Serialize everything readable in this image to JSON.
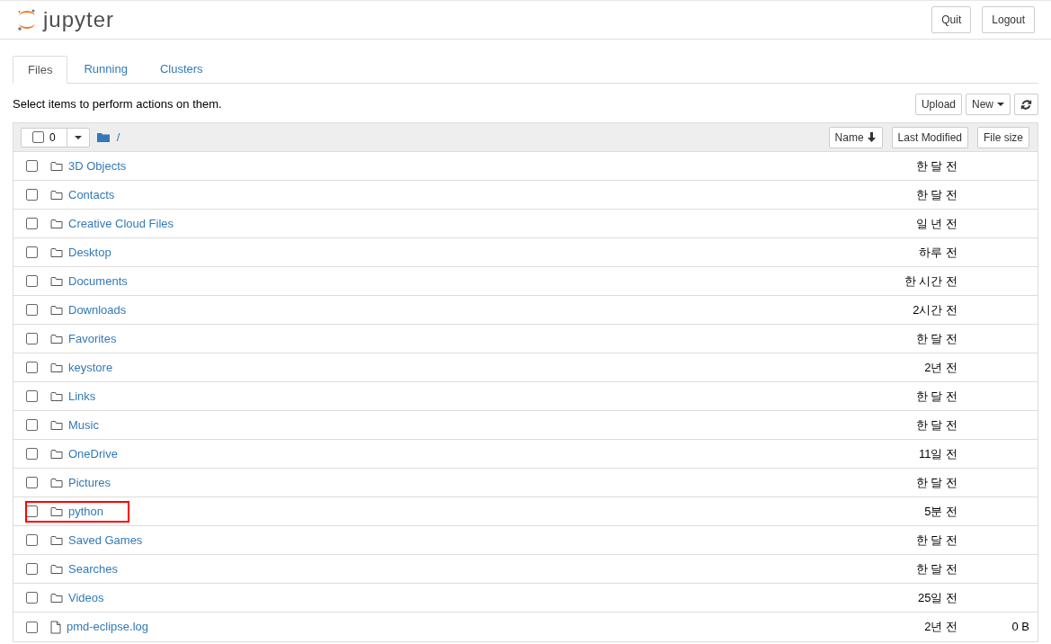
{
  "header": {
    "logo": "jupyter",
    "buttons": [
      "Quit",
      "Logout"
    ]
  },
  "tabs": [
    {
      "label": "Files",
      "selected": true
    },
    {
      "label": "Running",
      "selected": false
    },
    {
      "label": "Clusters",
      "selected": false
    }
  ],
  "toolbar": {
    "hint": "Select items to perform actions on them.",
    "upload": "Upload",
    "new": "New"
  },
  "list_header": {
    "checked": false,
    "count": "0",
    "path": "/",
    "sort_buttons": [
      "Name",
      "Last Modified",
      "File size"
    ]
  },
  "rows": [
    {
      "kind": "folder",
      "name": "3D Objects",
      "modified": "한 달 전",
      "checked": false,
      "highlighted": false
    },
    {
      "kind": "folder",
      "name": "Contacts",
      "modified": "한 달 전",
      "checked": false,
      "highlighted": false
    },
    {
      "kind": "folder",
      "name": "Creative Cloud Files",
      "modified": "일 년 전",
      "checked": false,
      "highlighted": false
    },
    {
      "kind": "folder",
      "name": "Desktop",
      "modified": "하루 전",
      "checked": false,
      "highlighted": false
    },
    {
      "kind": "folder",
      "name": "Documents",
      "modified": "한 시간 전",
      "checked": false,
      "highlighted": false
    },
    {
      "kind": "folder",
      "name": "Downloads",
      "modified": "2시간 전",
      "checked": false,
      "highlighted": false
    },
    {
      "kind": "folder",
      "name": "Favorites",
      "modified": "한 달 전",
      "checked": false,
      "highlighted": false
    },
    {
      "kind": "folder",
      "name": "keystore",
      "modified": "2년 전",
      "checked": false,
      "highlighted": false
    },
    {
      "kind": "folder",
      "name": "Links",
      "modified": "한 달 전",
      "checked": false,
      "highlighted": false
    },
    {
      "kind": "folder",
      "name": "Music",
      "modified": "한 달 전",
      "checked": false,
      "highlighted": false
    },
    {
      "kind": "folder",
      "name": "OneDrive",
      "modified": "11일 전",
      "checked": false,
      "highlighted": false
    },
    {
      "kind": "folder",
      "name": "Pictures",
      "modified": "한 달 전",
      "checked": false,
      "highlighted": false
    },
    {
      "kind": "folder",
      "name": "python",
      "modified": "5분 전",
      "checked": false,
      "highlighted": true
    },
    {
      "kind": "folder",
      "name": "Saved Games",
      "modified": "한 달 전",
      "checked": false,
      "highlighted": false
    },
    {
      "kind": "folder",
      "name": "Searches",
      "modified": "한 달 전",
      "checked": false,
      "highlighted": false
    },
    {
      "kind": "folder",
      "name": "Videos",
      "modified": "25일 전",
      "checked": false,
      "highlighted": false
    },
    {
      "kind": "file",
      "name": "pmd-eclipse.log",
      "modified": "2년 전",
      "size": "0 B",
      "checked": false,
      "highlighted": false
    }
  ]
}
